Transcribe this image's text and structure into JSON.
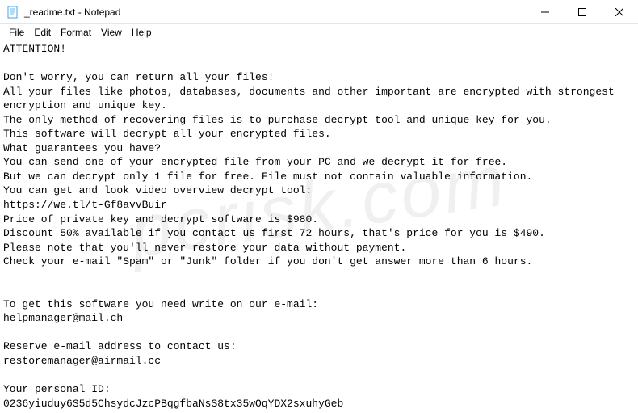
{
  "window": {
    "title": "_readme.txt - Notepad"
  },
  "menubar": {
    "items": [
      "File",
      "Edit",
      "Format",
      "View",
      "Help"
    ]
  },
  "editor": {
    "content": "ATTENTION!\n\nDon't worry, you can return all your files!\nAll your files like photos, databases, documents and other important are encrypted with strongest encryption and unique key.\nThe only method of recovering files is to purchase decrypt tool and unique key for you.\nThis software will decrypt all your encrypted files.\nWhat guarantees you have?\nYou can send one of your encrypted file from your PC and we decrypt it for free.\nBut we can decrypt only 1 file for free. File must not contain valuable information.\nYou can get and look video overview decrypt tool:\nhttps://we.tl/t-Gf8avvBuir\nPrice of private key and decrypt software is $980.\nDiscount 50% available if you contact us first 72 hours, that's price for you is $490.\nPlease note that you'll never restore your data without payment.\nCheck your e-mail \"Spam\" or \"Junk\" folder if you don't get answer more than 6 hours.\n\n\nTo get this software you need write on our e-mail:\nhelpmanager@mail.ch\n\nReserve e-mail address to contact us:\nrestoremanager@airmail.cc\n\nYour personal ID:\n0236yiuduy6S5d5ChsydcJzcPBqgfbaNsS8tx35wOqYDX2sxuhyGeb"
  },
  "watermark": {
    "text": "pcrisk.com"
  }
}
